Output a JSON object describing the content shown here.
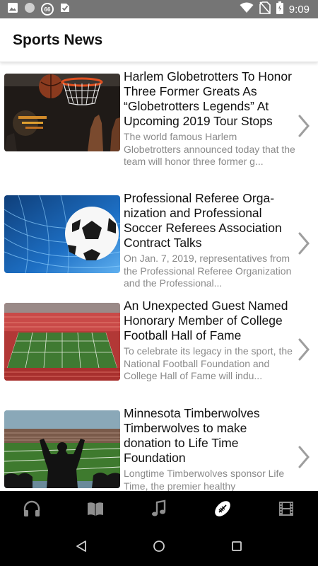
{
  "status_bar": {
    "time": "9:09",
    "badge": "66",
    "icons": [
      "image-icon",
      "circle-icon",
      "badge-66-icon",
      "check-icon",
      "wifi-icon",
      "no-sim-icon",
      "battery-icon"
    ]
  },
  "app_bar": {
    "title": "Sports News"
  },
  "news": [
    {
      "title": "Harlem Globetrotters To Honor Three Former Greats As “Globetrotters Legends” At Upcoming 2019 Tour Stops",
      "summary": "The world famous Harlem Globetrotters announced today that the team will honor three former g...",
      "thumbnail": "basketball-hoop-image"
    },
    {
      "title": "Professional Referee Orga-nization and Professional Soccer Referees Association Contract Talks",
      "summary": "On Jan. 7, 2019, representatives from the Professional Referee Organization and the Professional...",
      "thumbnail": "soccer-ball-net-image"
    },
    {
      "title": "An Unexpected Guest Named Honorary Member of College Football Hall of Fame",
      "summary": "To celebrate its legacy in the sport, the National Football Foundation and College Hall of Fame will indu...",
      "thumbnail": "football-stadium-image"
    },
    {
      "title": "Minnesota Timberwolves Timberwolves to make donation to Life Time Foundation",
      "summary": "Longtime Timberwolves sponsor Life Time, the premier healthy",
      "thumbnail": "stadium-crowd-image"
    }
  ],
  "bottom_nav": {
    "tabs": [
      "headphones-icon",
      "book-icon",
      "music-note-icon",
      "football-icon",
      "film-icon"
    ],
    "active_tab": "football-icon"
  },
  "system_nav": [
    "back-icon",
    "home-icon",
    "recents-icon"
  ],
  "colors": {
    "status_bar": "#757575",
    "title_text": "#111111",
    "summary_text": "#8a8a8a",
    "chevron": "#9e9e9e",
    "nav_background": "#000000",
    "nav_icon": "#8f8f8f",
    "nav_icon_active": "#ffffff"
  }
}
